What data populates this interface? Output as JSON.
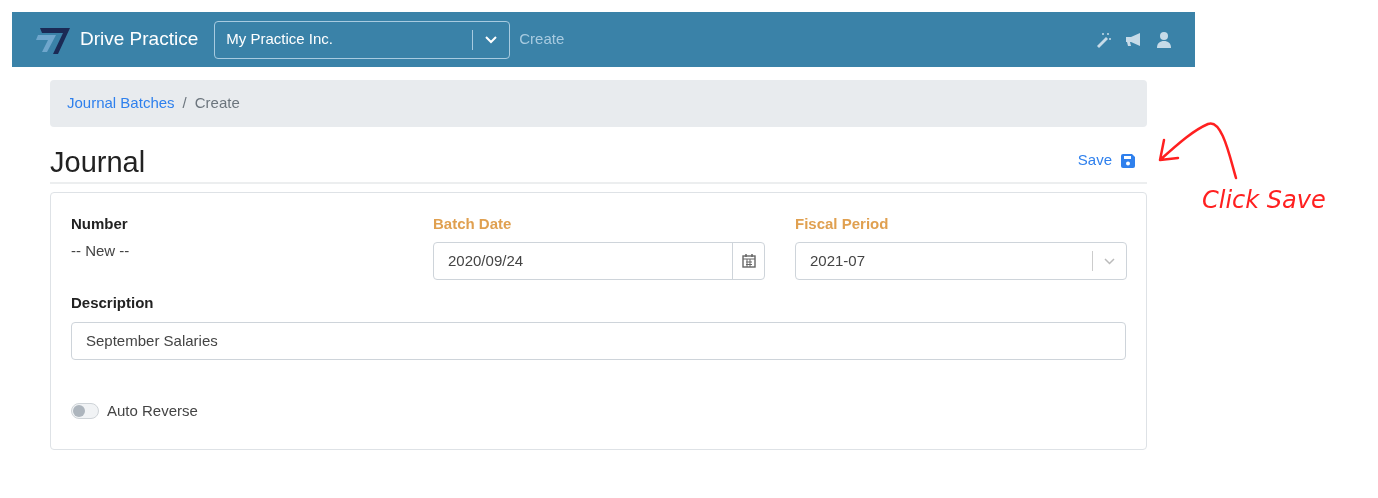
{
  "navbar": {
    "brand": "Drive Practice",
    "company_select": {
      "value": "My Practice Inc."
    },
    "page_label": "Create"
  },
  "breadcrumb": {
    "separator": "/",
    "items": [
      {
        "label": "Journal Batches",
        "kind": "link"
      },
      {
        "label": "Create",
        "kind": "current"
      }
    ]
  },
  "page_title": "Journal",
  "save_action": {
    "label": "Save"
  },
  "form": {
    "fields": [
      {
        "label": "Number",
        "kind": "static",
        "required": false,
        "value": "-- New --"
      },
      {
        "label": "Batch Date",
        "kind": "date",
        "required": true,
        "value": "2020/09/24"
      },
      {
        "label": "Fiscal Period",
        "kind": "select",
        "required": true,
        "value": "2021-07"
      },
      {
        "label": "Description",
        "kind": "text",
        "required": false,
        "value": "September Salaries"
      }
    ],
    "toggle": {
      "label": "Auto Reverse",
      "on": false
    }
  },
  "annotation": {
    "text": "Click Save"
  }
}
